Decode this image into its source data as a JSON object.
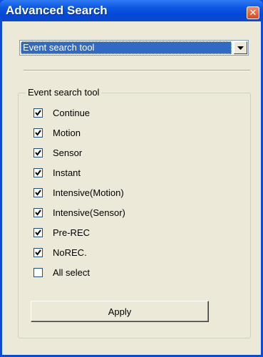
{
  "window": {
    "title": "Advanced Search",
    "close_glyph": "✕",
    "title_bar_color": "#0548d6",
    "client_color": "#ece9d8"
  },
  "search_type": {
    "selected": "Event search tool"
  },
  "group": {
    "legend": "Event search tool",
    "items": [
      {
        "label": "Continue",
        "checked": true
      },
      {
        "label": "Motion",
        "checked": true
      },
      {
        "label": "Sensor",
        "checked": true
      },
      {
        "label": "Instant",
        "checked": true
      },
      {
        "label": "Intensive(Motion)",
        "checked": true
      },
      {
        "label": "Intensive(Sensor)",
        "checked": true
      },
      {
        "label": "Pre-REC",
        "checked": true
      },
      {
        "label": "NoREC.",
        "checked": true
      },
      {
        "label": "All select",
        "checked": false
      }
    ]
  },
  "apply_label": "Apply"
}
